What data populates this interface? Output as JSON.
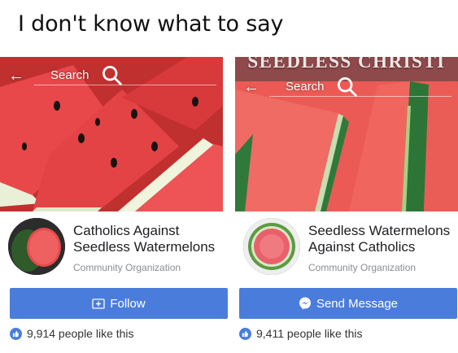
{
  "caption": "I don't know what to say",
  "left_page": {
    "search_placeholder": "Search",
    "name_line1": "Catholics Against",
    "name_line2": "Seedless Watermelons",
    "category": "Community Organization",
    "action_label": "Follow",
    "action_icon": "follow-icon",
    "likes": "9,914 people like this"
  },
  "right_page": {
    "cover_text": "SEEDLESS CHRISTI",
    "search_placeholder": "Search",
    "name_line1": "Seedless Watermelons",
    "name_line2": "Against Catholics",
    "category": "Community Organization",
    "action_label": "Send Message",
    "action_icon": "messenger-icon",
    "likes": "9,411 people like this"
  },
  "colors": {
    "accent": "#4a7ddb",
    "watermelon_flesh": "#e23c3c",
    "watermelon_rind": "#2f7a3a"
  }
}
